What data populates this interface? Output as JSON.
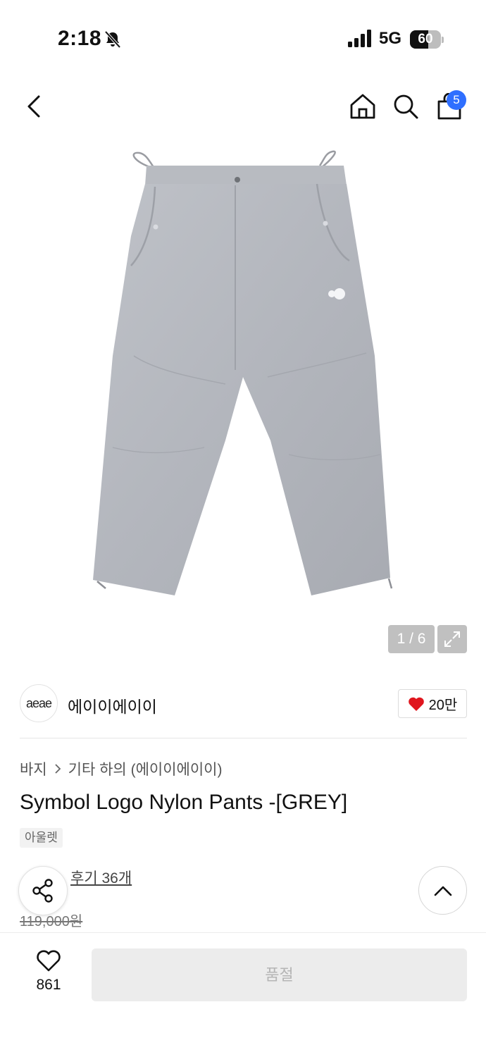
{
  "status_bar": {
    "time": "2:18",
    "network": "5G",
    "battery_level": "60",
    "battery_fraction": 0.6
  },
  "nav": {
    "icons": [
      "back-icon",
      "home-icon",
      "search-icon",
      "shopping-bag-icon"
    ],
    "cart_count": "5"
  },
  "gallery": {
    "counter": "1 / 6",
    "expand_icon": "expand-icon"
  },
  "brand": {
    "logo_text": "aeae",
    "name": "에이이에이이",
    "like_count": "20만",
    "heart_color": "#e0161e"
  },
  "product": {
    "breadcrumb": [
      "바지",
      "기타 하의 (에이이에이이)"
    ],
    "title": "Symbol Logo Nylon Pants -[GREY]",
    "tag": "아울렛",
    "review_link": "후기 36개",
    "original_price": "119,000원"
  },
  "bottom_bar": {
    "wish_count": "861",
    "buy_label": "품절"
  },
  "colors": {
    "badge": "#2f6fff",
    "disabled_button": "#ececec"
  }
}
